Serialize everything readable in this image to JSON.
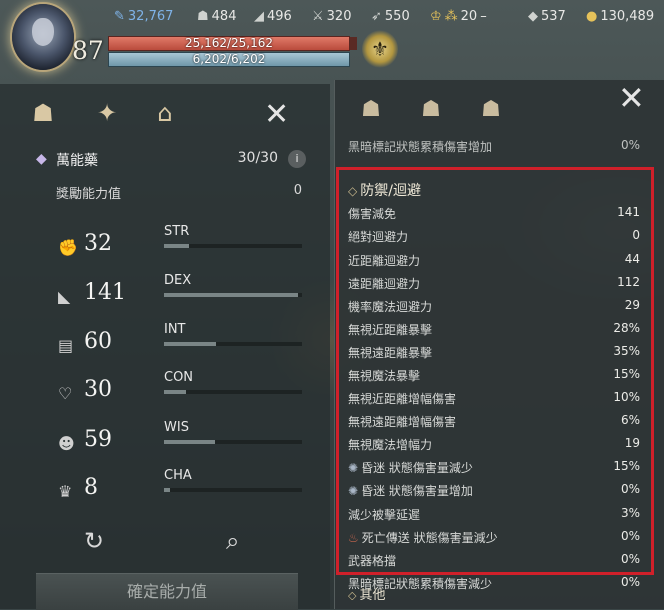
{
  "hud": {
    "level": "87",
    "hp": "25,162/25,162",
    "mp": "6,202/6,202",
    "stats": [
      {
        "icon": "feather-icon",
        "glyph": "✎",
        "value": "32,767",
        "highlight": true
      },
      {
        "icon": "helmet-icon",
        "glyph": "☗",
        "value": "484"
      },
      {
        "icon": "boot-icon",
        "glyph": "◢",
        "value": "496"
      },
      {
        "icon": "crossed-swords-icon",
        "glyph": "⚔",
        "value": "320"
      },
      {
        "icon": "bow-icon",
        "glyph": "➶",
        "value": "550"
      },
      {
        "icon": "trophy-icon",
        "glyph": "♔",
        "value": ""
      },
      {
        "icon": "stars-icon",
        "glyph": "⁂",
        "value": "20"
      },
      {
        "icon": "dash-icon",
        "glyph": "–",
        "value": ""
      },
      {
        "icon": "diamond-icon",
        "glyph": "◆",
        "value": "537"
      },
      {
        "icon": "gold-coin-icon",
        "glyph": "●",
        "value": "130,489"
      }
    ]
  },
  "left": {
    "potion_label": "萬能藥",
    "potion_count": "30/30",
    "info_glyph": "i",
    "reward_label": "獎勵能力值",
    "reward_value": "0",
    "stats": [
      {
        "name": "STR",
        "value": "32",
        "fill": 0.18
      },
      {
        "name": "DEX",
        "value": "141",
        "fill": 0.97
      },
      {
        "name": "INT",
        "value": "60",
        "fill": 0.38
      },
      {
        "name": "CON",
        "value": "30",
        "fill": 0.16
      },
      {
        "name": "WIS",
        "value": "59",
        "fill": 0.37
      },
      {
        "name": "CHA",
        "value": "8",
        "fill": 0.04
      }
    ],
    "confirm_label": "確定能力值"
  },
  "right": {
    "partial_top": {
      "label": "黑暗標記狀態累積傷害增加",
      "value": "0%"
    },
    "section_title": "防禦/迴避",
    "rows": [
      {
        "label": "傷害減免",
        "value": "141"
      },
      {
        "label": "絕對迴避力",
        "value": "0"
      },
      {
        "label": "近距離迴避力",
        "value": "44"
      },
      {
        "label": "遠距離迴避力",
        "value": "112"
      },
      {
        "label": "機率魔法迴避力",
        "value": "29"
      },
      {
        "label": "無視近距離暴擊",
        "value": "28%"
      },
      {
        "label": "無視遠距離暴擊",
        "value": "35%"
      },
      {
        "label": "無視魔法暴擊",
        "value": "15%"
      },
      {
        "label": "無視近距離增幅傷害",
        "value": "10%"
      },
      {
        "label": "無視遠距離增幅傷害",
        "value": "6%"
      },
      {
        "label": "無視魔法增幅力",
        "value": "19"
      },
      {
        "label": "昏迷 狀態傷害量減少",
        "value": "15%",
        "icon": "stun-icon"
      },
      {
        "label": "昏迷 狀態傷害量增加",
        "value": "0%",
        "icon": "stun-icon"
      },
      {
        "label": "減少被擊延遲",
        "value": "3%"
      },
      {
        "label": "死亡傳送 狀態傷害量減少",
        "value": "0%",
        "icon": "death-teleport-icon"
      },
      {
        "label": "武器格擋",
        "value": "0%"
      },
      {
        "label": "黑暗標記狀態累積傷害減少",
        "value": "0%"
      }
    ],
    "next_section": "其他"
  },
  "colors": {
    "highlight_border": "#d0202a",
    "hp": "#c95a4a",
    "mp": "#86aebf"
  }
}
